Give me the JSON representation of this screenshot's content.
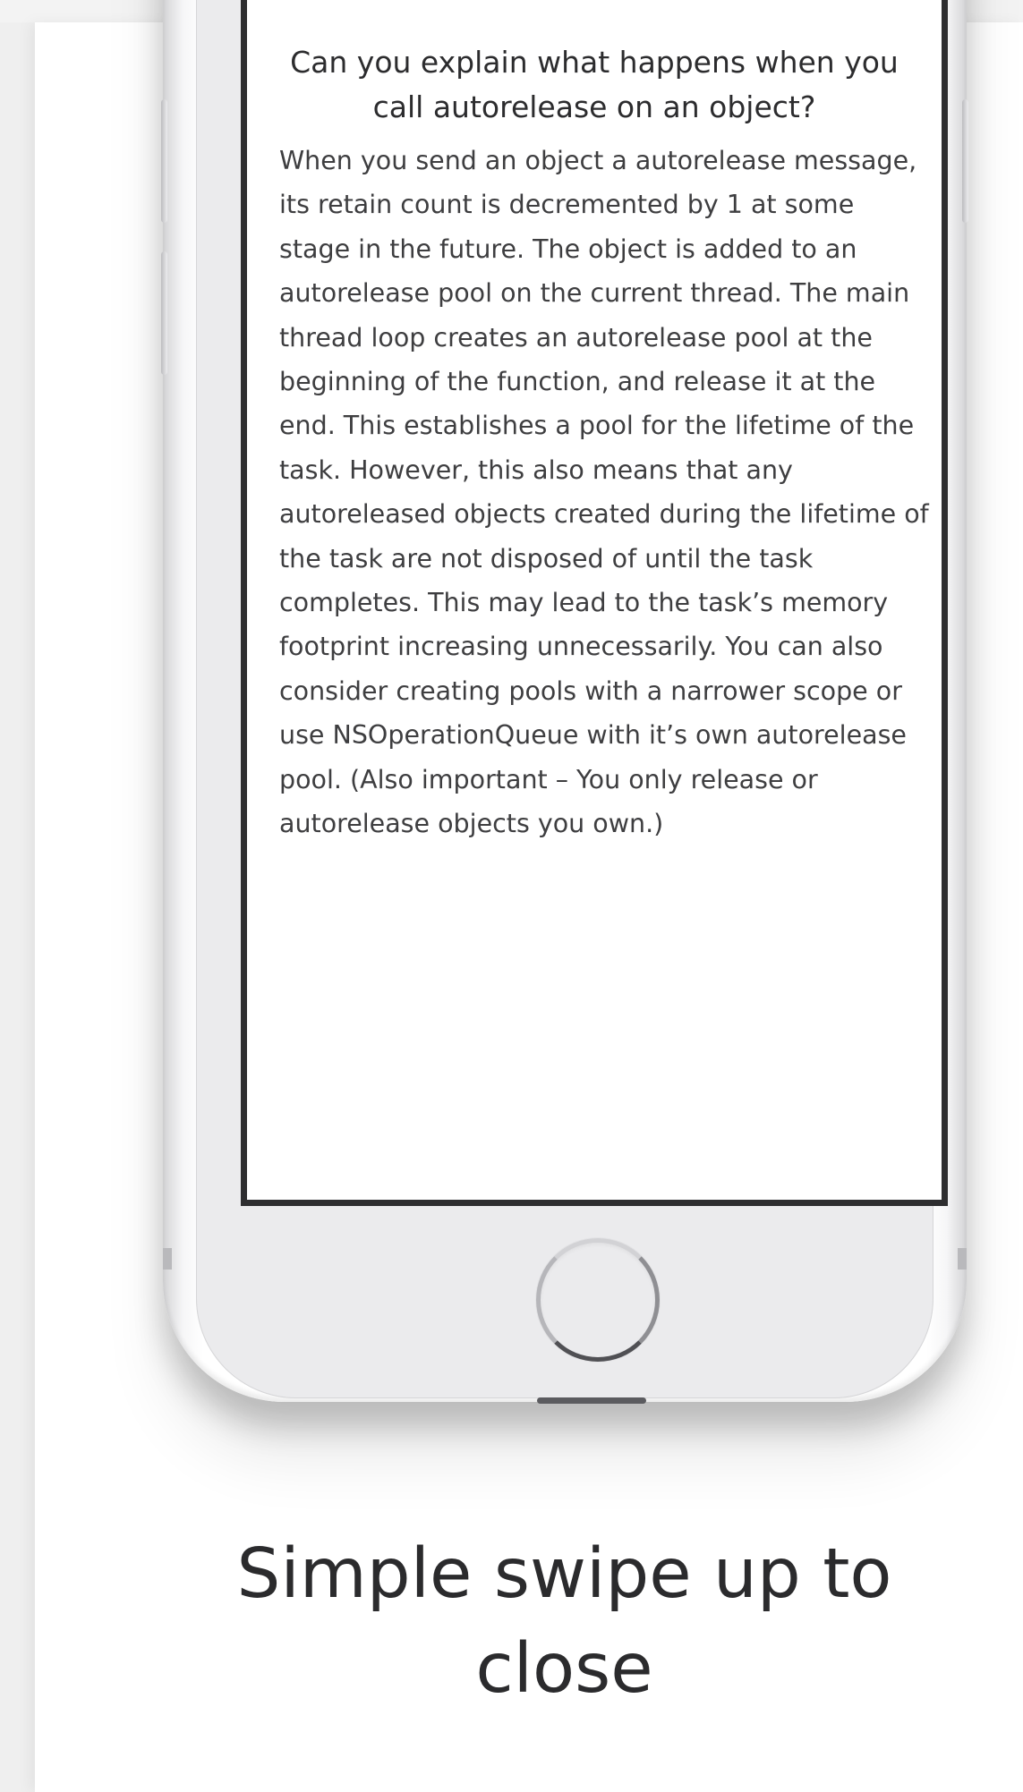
{
  "card": {
    "question": "Can you explain what happens when you call autorelease on an object?",
    "answer": "When you send an object a autorelease message, its retain count is decremented by 1 at some stage in the future. The object is added to an autorelease pool on the current thread. The main thread loop creates an autorelease pool at the beginning of the function, and release it at the end. This establishes a pool for the lifetime of the task. However, this also means that any autoreleased objects created during the lifetime of the task are not disposed of until the task completes. This may lead to the task’s memory footprint increasing unnecessarily. You can also consider creating pools with a narrower scope or use NSOperationQueue with it’s own autorelease pool. (Also important – You only release or autorelease objects you own.)"
  },
  "caption": {
    "text": "Simple swipe up to close"
  },
  "device": {
    "icons": [
      "home-button-icon",
      "speaker-grille-icon"
    ],
    "colors": {
      "screen_border": "#2e2e30",
      "bezel": "#ebebed",
      "text": "#2c2c2e"
    }
  }
}
